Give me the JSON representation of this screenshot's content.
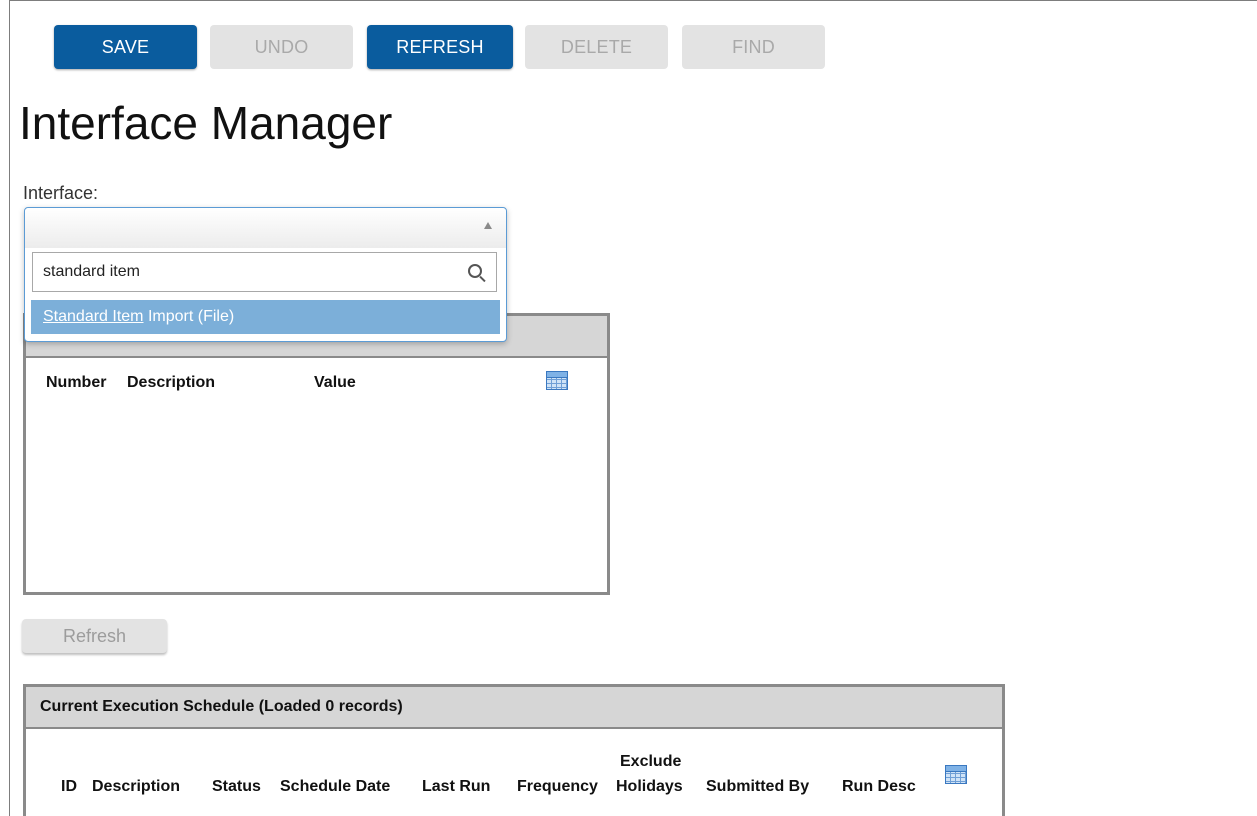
{
  "toolbar": {
    "save": "SAVE",
    "undo": "UNDO",
    "refresh": "REFRESH",
    "delete": "DELETE",
    "find": "FIND"
  },
  "page": {
    "title": "Interface Manager"
  },
  "interface": {
    "label": "Interface:",
    "selected": "",
    "search_value": "standard item",
    "option": {
      "match": "Standard Item",
      "rest": " Import (File)"
    }
  },
  "parameters_grid": {
    "columns": [
      "Number",
      "Description",
      "Value"
    ]
  },
  "refresh_button": "Refresh",
  "schedule_grid": {
    "title": "Current Execution Schedule (Loaded 0 records)",
    "columns": [
      "ID",
      "Description",
      "Status",
      "Schedule Date",
      "Last Run",
      "Frequency",
      "Exclude",
      "Holidays",
      "Submitted By",
      "Run Desc"
    ]
  },
  "colors": {
    "primary": "#0a5c9e",
    "disabled": "#e3e3e3",
    "option_highlight": "#7cafd9"
  },
  "icons": [
    "search-icon",
    "grid-columns-icon",
    "dropdown-arrow-icon"
  ]
}
